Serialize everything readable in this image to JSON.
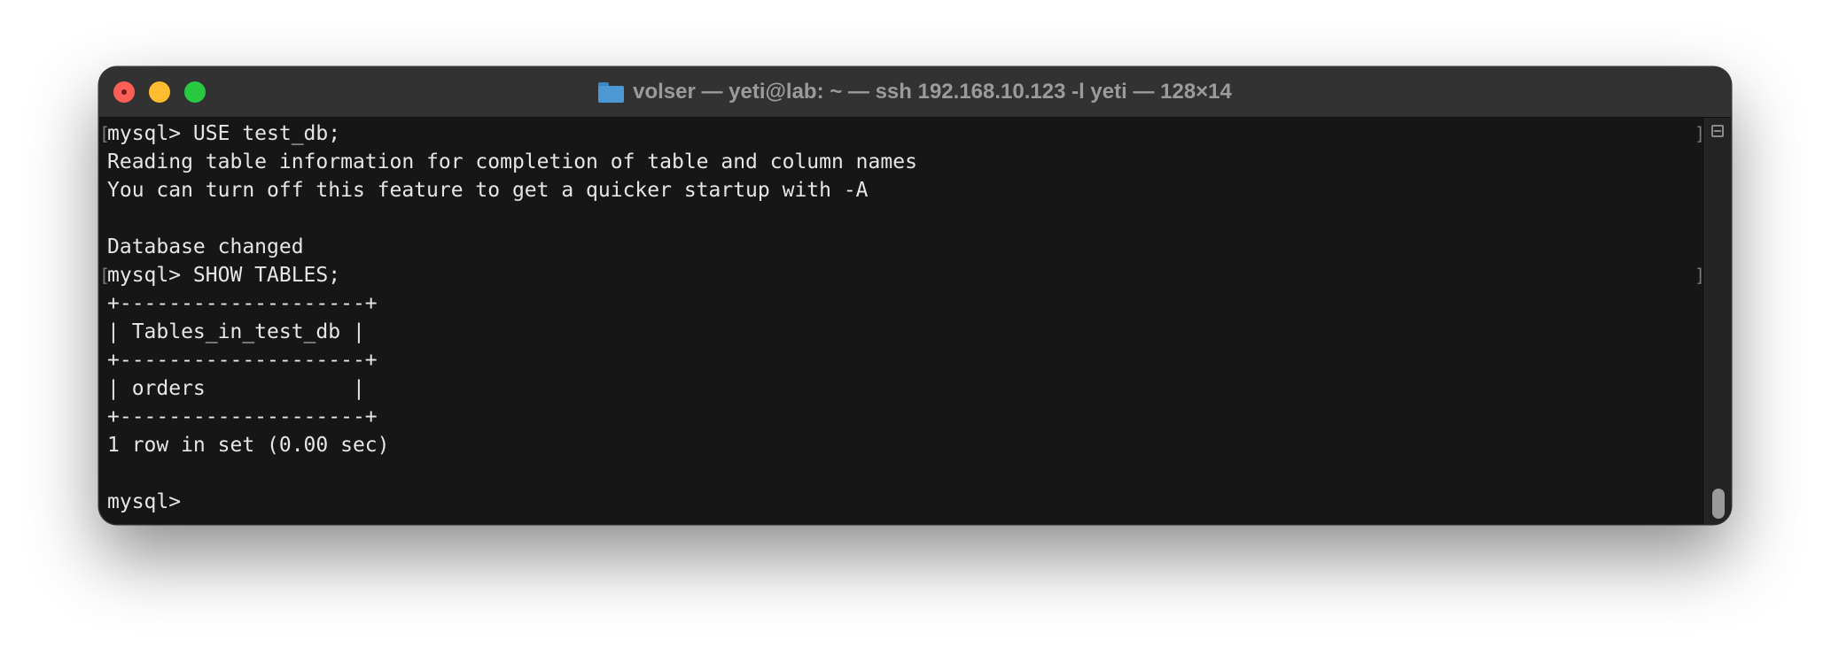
{
  "window": {
    "title": "volser — yeti@lab: ~ — ssh 192.168.10.123 -l yeti — 128×14",
    "folder_icon": "folder-icon"
  },
  "terminal": {
    "lines": [
      "mysql> USE test_db;",
      "Reading table information for completion of table and column names",
      "You can turn off this feature to get a quicker startup with -A",
      "",
      "Database changed",
      "mysql> SHOW TABLES;",
      "+--------------------+",
      "| Tables_in_test_db |",
      "+--------------------+",
      "| orders            |",
      "+--------------------+",
      "1 row in set (0.00 sec)",
      "",
      "mysql>"
    ],
    "mark_left": "[",
    "mark_right": "]"
  },
  "colors": {
    "close": "#fe5f57",
    "minimize": "#febc2e",
    "zoom": "#28c840",
    "background": "#161616",
    "text": "#e6e6e6"
  }
}
